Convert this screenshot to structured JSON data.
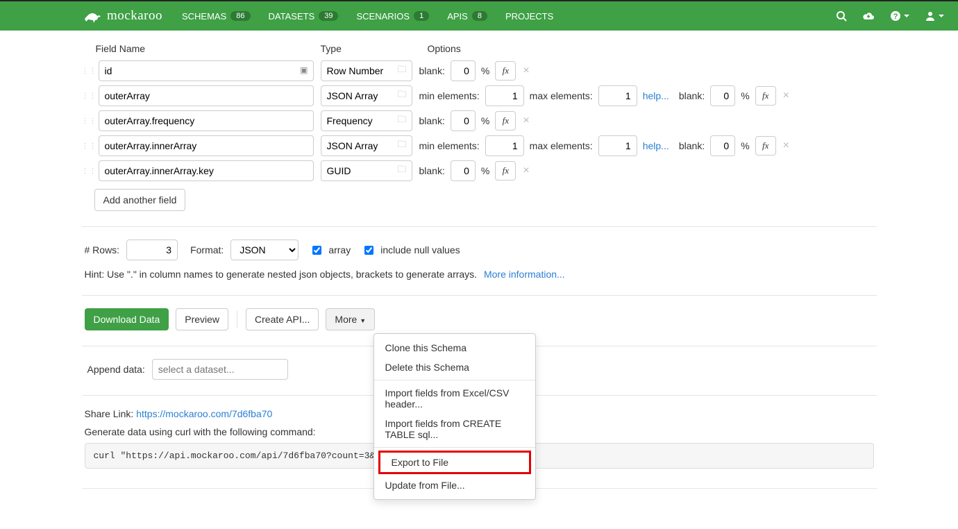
{
  "brand": "mockaroo",
  "nav": {
    "schemas": {
      "label": "SCHEMAS",
      "count": "86"
    },
    "datasets": {
      "label": "DATASETS",
      "count": "39"
    },
    "scenarios": {
      "label": "SCENARIOS",
      "count": "1"
    },
    "apis": {
      "label": "APIS",
      "count": "8"
    },
    "projects": {
      "label": "PROJECTS"
    }
  },
  "headers": {
    "name": "Field Name",
    "type": "Type",
    "options": "Options"
  },
  "fields": [
    {
      "name": "id",
      "type": "Row Number",
      "blank_label": "blank:",
      "blank": "0",
      "pct": "%"
    },
    {
      "name": "outerArray",
      "type": "JSON Array",
      "min_label": "min elements:",
      "min": "1",
      "max_label": "max elements:",
      "max": "1",
      "help": "help...",
      "blank_label": "blank:",
      "blank": "0",
      "pct": "%"
    },
    {
      "name": "outerArray.frequency",
      "type": "Frequency",
      "blank_label": "blank:",
      "blank": "0",
      "pct": "%"
    },
    {
      "name": "outerArray.innerArray",
      "type": "JSON Array",
      "min_label": "min elements:",
      "min": "1",
      "max_label": "max elements:",
      "max": "1",
      "help": "help...",
      "blank_label": "blank:",
      "blank": "0",
      "pct": "%"
    },
    {
      "name": "outerArray.innerArray.key",
      "type": "GUID",
      "blank_label": "blank:",
      "blank": "0",
      "pct": "%"
    }
  ],
  "add_field": "Add another field",
  "config": {
    "rows_label": "# Rows:",
    "rows": "3",
    "format_label": "Format:",
    "format": "JSON",
    "array_label": "array",
    "nulls_label": "include null values"
  },
  "hint": {
    "text": "Hint: Use \".\" in column names to generate nested json objects, brackets to generate arrays.",
    "more": "More information..."
  },
  "actions": {
    "download": "Download Data",
    "preview": "Preview",
    "create_api": "Create API...",
    "more": "More "
  },
  "more_menu": {
    "clone": "Clone this Schema",
    "delete": "Delete this Schema",
    "import_excel": "Import fields from Excel/CSV header...",
    "import_sql": "Import fields from CREATE TABLE sql...",
    "export": "Export to File",
    "update": "Update from File..."
  },
  "append": {
    "label": "Append data:",
    "placeholder": "select a dataset..."
  },
  "share": {
    "label": "Share Link: ",
    "url": "https://mockaroo.com/7d6fba70"
  },
  "curl": {
    "label": "Generate data using curl with the following command:",
    "cmd": "curl \"https://api.mockaroo.com/api/7d6fba70?count=3&key=5ebc29b0\" > \"4452.json\""
  },
  "fx": "fx",
  "x": "×"
}
